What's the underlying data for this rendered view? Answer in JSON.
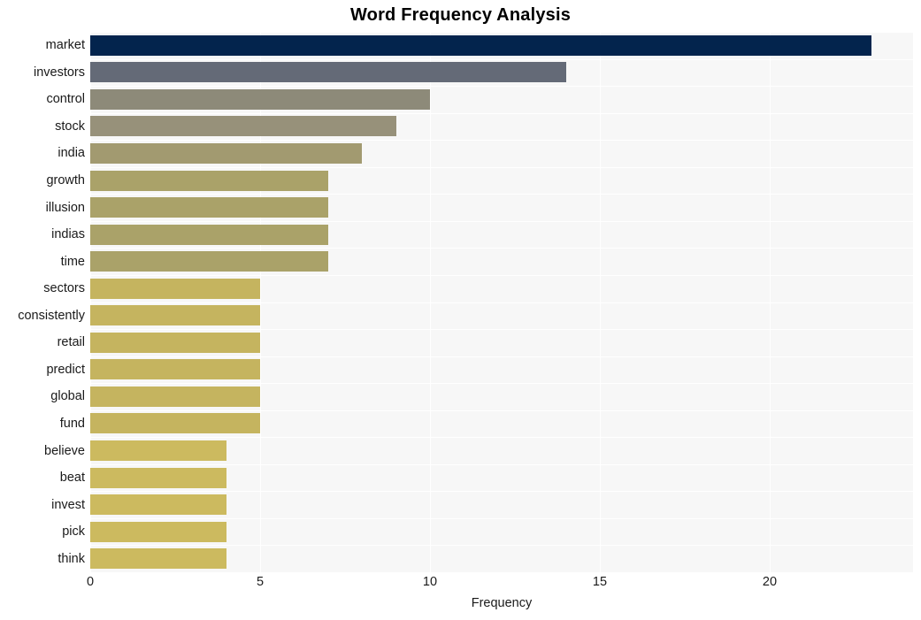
{
  "chart_data": {
    "type": "bar",
    "orientation": "horizontal",
    "title": "Word Frequency Analysis",
    "xlabel": "Frequency",
    "ylabel": "",
    "categories": [
      "market",
      "investors",
      "control",
      "stock",
      "india",
      "growth",
      "illusion",
      "indias",
      "time",
      "sectors",
      "consistently",
      "retail",
      "predict",
      "global",
      "fund",
      "believe",
      "beat",
      "invest",
      "pick",
      "think"
    ],
    "values": [
      23,
      14,
      10,
      9,
      8,
      7,
      7,
      7,
      7,
      5,
      5,
      5,
      5,
      5,
      5,
      4,
      4,
      4,
      4,
      4
    ],
    "bar_colors": [
      "#03244d",
      "#646a77",
      "#8d8a79",
      "#97917a",
      "#a29a70",
      "#aaa269",
      "#aaa269",
      "#aaa269",
      "#aaa269",
      "#c5b45f",
      "#c5b45f",
      "#c5b45f",
      "#c5b45f",
      "#c5b45f",
      "#c5b45f",
      "#ccba5f",
      "#ccba5f",
      "#ccba5f",
      "#ccba5f",
      "#ccba5f"
    ],
    "xticks": [
      0,
      5,
      10,
      15,
      20
    ],
    "xtick_labels": [
      "0",
      "5",
      "10",
      "15",
      "20"
    ],
    "xlim": [
      0,
      24.22
    ],
    "grid": true,
    "grid_color": "#ffffff",
    "plot_background": "#f7f7f7",
    "figure_background": "#ffffff",
    "legend": null
  }
}
